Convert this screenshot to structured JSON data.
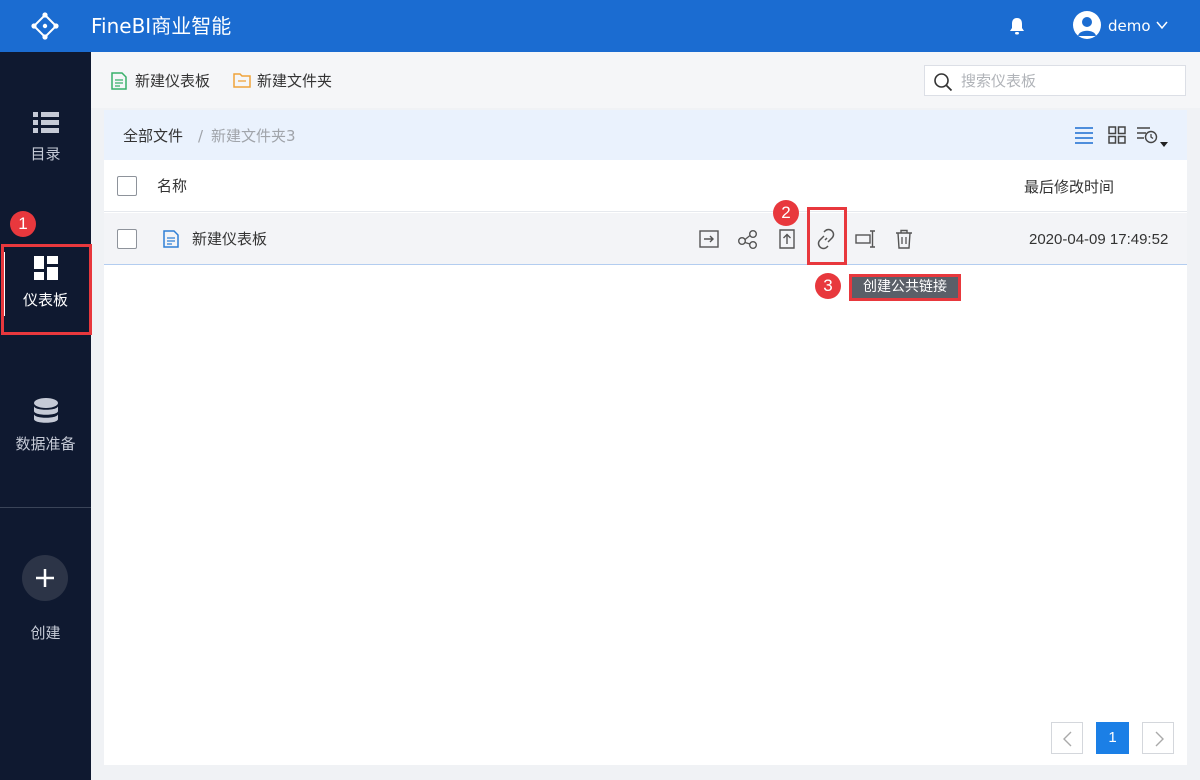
{
  "app": {
    "title": "FineBI商业智能",
    "user": "demo"
  },
  "sidebar": {
    "items": [
      {
        "label": "目录",
        "icon": "list-icon"
      },
      {
        "label": "仪表板",
        "icon": "dashboard-icon",
        "active": true
      },
      {
        "label": "数据准备",
        "icon": "database-icon"
      }
    ],
    "create_label": "创建"
  },
  "toolbar": {
    "new_dashboard_label": "新建仪表板",
    "new_folder_label": "新建文件夹",
    "search_placeholder": "搜索仪表板"
  },
  "breadcrumb": {
    "root": "全部文件",
    "separator": "/",
    "current": "新建文件夹3"
  },
  "table": {
    "columns": [
      "名称",
      "最后修改时间"
    ],
    "rows": [
      {
        "name": "新建仪表板",
        "modified": "2020-04-09 17:49:52"
      }
    ]
  },
  "tooltip": "创建公共链接",
  "annotations": [
    "1",
    "2",
    "3"
  ],
  "pagination": {
    "current": "1"
  },
  "colors": {
    "topbar": "#1b6cd1",
    "sidebar": "#0f1930",
    "accent": "#1b7fe6",
    "annotation": "#e8383d"
  }
}
